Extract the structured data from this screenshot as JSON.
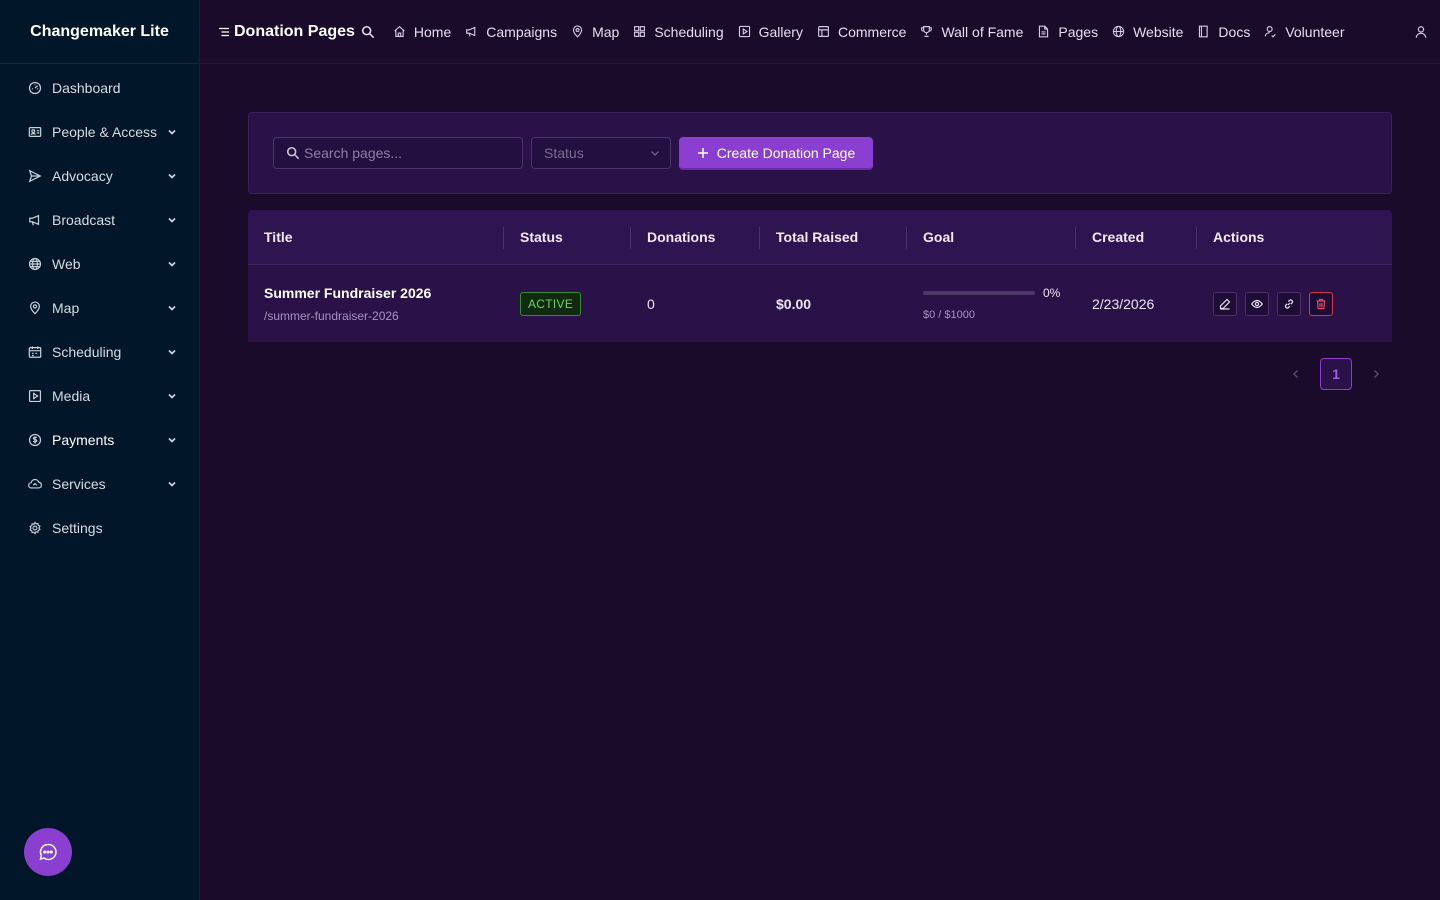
{
  "app": {
    "name": "Changemaker Lite"
  },
  "sidebar": {
    "items": [
      {
        "label": "Dashboard",
        "icon": "dashboard-icon",
        "has_children": false
      },
      {
        "label": "People & Access",
        "icon": "people-icon",
        "has_children": true
      },
      {
        "label": "Advocacy",
        "icon": "send-icon",
        "has_children": true
      },
      {
        "label": "Broadcast",
        "icon": "megaphone-icon",
        "has_children": true
      },
      {
        "label": "Web",
        "icon": "globe-icon",
        "has_children": true
      },
      {
        "label": "Map",
        "icon": "pin-icon",
        "has_children": true
      },
      {
        "label": "Scheduling",
        "icon": "calendar-icon",
        "has_children": true
      },
      {
        "label": "Media",
        "icon": "play-icon",
        "has_children": true
      },
      {
        "label": "Payments",
        "icon": "dollar-icon",
        "has_children": true,
        "active": true
      },
      {
        "label": "Services",
        "icon": "cloud-icon",
        "has_children": true
      },
      {
        "label": "Settings",
        "icon": "gear-icon",
        "has_children": false
      }
    ]
  },
  "header": {
    "title": "Donation Pages",
    "links": [
      {
        "label": "Home",
        "icon": "home-icon"
      },
      {
        "label": "Campaigns",
        "icon": "megaphone-icon"
      },
      {
        "label": "Map",
        "icon": "pin-icon"
      },
      {
        "label": "Scheduling",
        "icon": "grid-icon"
      },
      {
        "label": "Gallery",
        "icon": "play-icon"
      },
      {
        "label": "Commerce",
        "icon": "store-icon"
      },
      {
        "label": "Wall of Fame",
        "icon": "trophy-icon"
      },
      {
        "label": "Pages",
        "icon": "file-icon"
      },
      {
        "label": "Website",
        "icon": "globe-icon"
      },
      {
        "label": "Docs",
        "icon": "book-icon"
      },
      {
        "label": "Volunteer",
        "icon": "volunteer-icon"
      }
    ]
  },
  "filters": {
    "search_placeholder": "Search pages...",
    "status_placeholder": "Status",
    "create_label": "Create Donation Page"
  },
  "table": {
    "columns": [
      "Title",
      "Status",
      "Donations",
      "Total Raised",
      "Goal",
      "Created",
      "Actions"
    ],
    "rows": [
      {
        "title": "Summer Fundraiser 2026",
        "slug": "/summer-fundraiser-2026",
        "status": "ACTIVE",
        "donations": "0",
        "total_raised": "$0.00",
        "goal_progress": 0,
        "goal_percent": "0%",
        "goal_text": "$0 / $1000",
        "created": "2/23/2026"
      }
    ]
  },
  "pagination": {
    "current": "1"
  },
  "colors": {
    "accent": "#8a3fd1",
    "sidebar_bg": "#02162a",
    "page_bg": "#1a0b2a",
    "active_badge": "#6ed45c",
    "danger": "#e34a5c"
  }
}
